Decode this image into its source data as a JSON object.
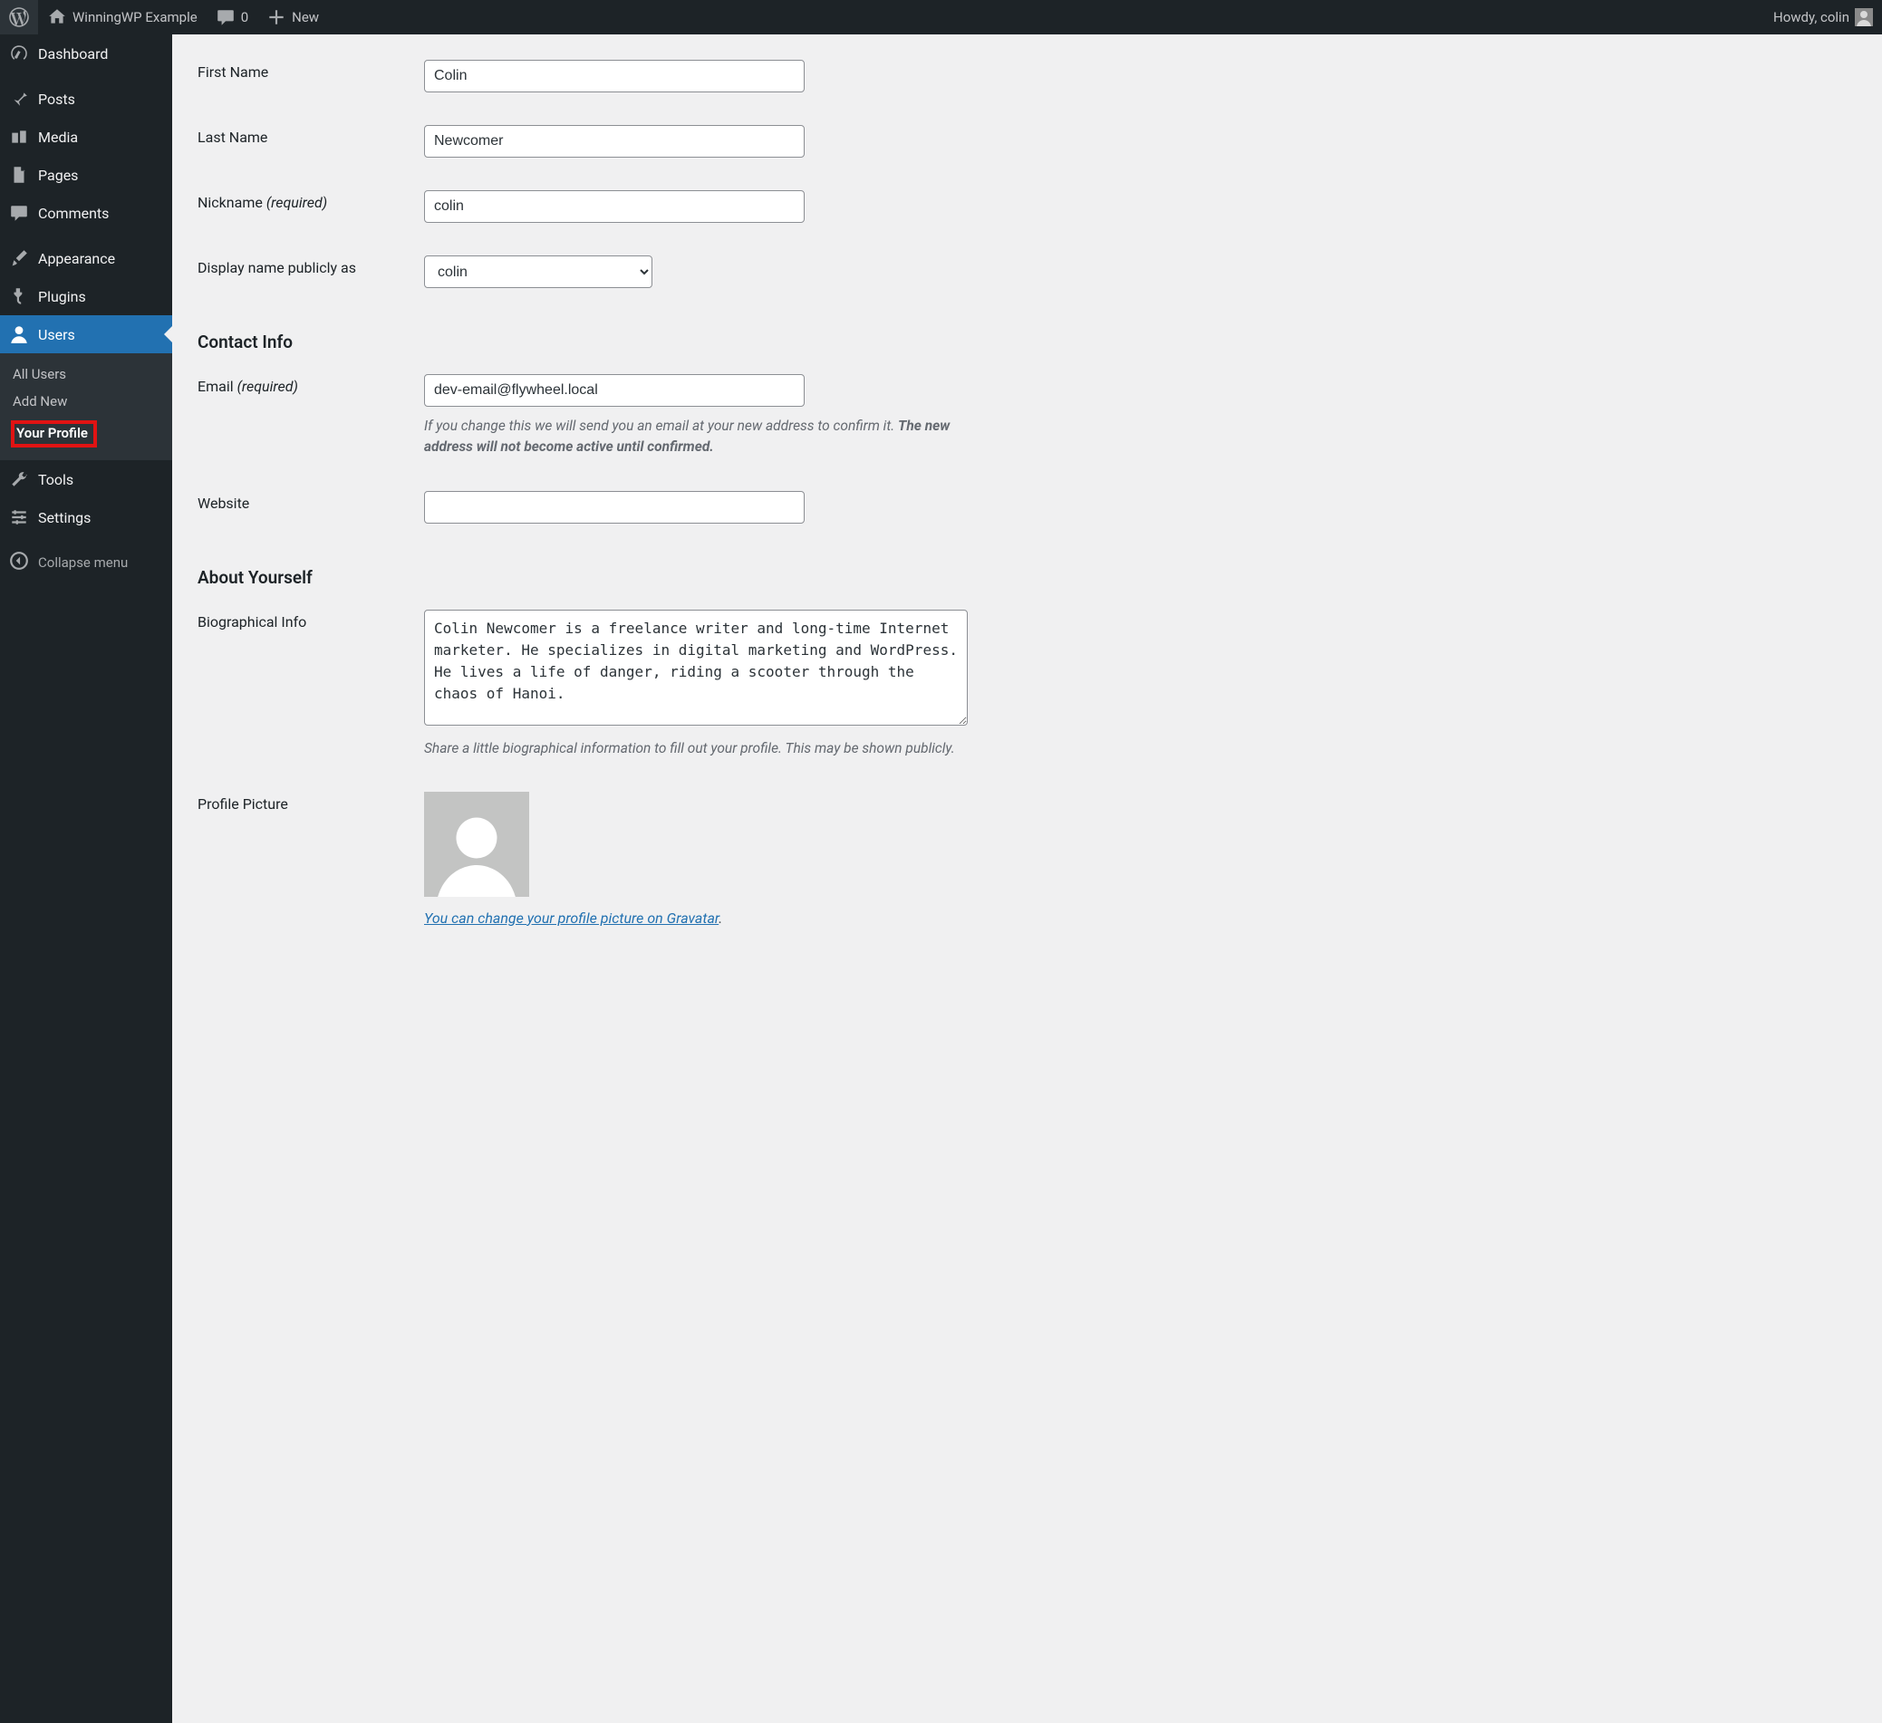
{
  "adminbar": {
    "site_name": "WinningWP Example",
    "comments_count": "0",
    "new_label": "New",
    "greeting": "Howdy, colin"
  },
  "sidebar": {
    "dashboard": "Dashboard",
    "posts": "Posts",
    "media": "Media",
    "pages": "Pages",
    "comments": "Comments",
    "appearance": "Appearance",
    "plugins": "Plugins",
    "users": "Users",
    "users_sub": {
      "all": "All Users",
      "add": "Add New",
      "profile": "Your Profile"
    },
    "tools": "Tools",
    "settings": "Settings",
    "collapse": "Collapse menu"
  },
  "form": {
    "first_name_label": "First Name",
    "first_name_value": "Colin",
    "last_name_label": "Last Name",
    "last_name_value": "Newcomer",
    "nickname_label": "Nickname ",
    "required_text": "(required)",
    "nickname_value": "colin",
    "display_name_label": "Display name publicly as",
    "display_name_value": "colin",
    "contact_heading": "Contact Info",
    "email_label": "Email ",
    "email_value": "dev-email@flywheel.local",
    "email_desc_1": "If you change this we will send you an email at your new address to confirm it. ",
    "email_desc_2": "The new address will not become active until confirmed.",
    "website_label": "Website",
    "website_value": "",
    "about_heading": "About Yourself",
    "bio_label": "Biographical Info",
    "bio_value": "Colin Newcomer is a freelance writer and long-time Internet marketer. He specializes in digital marketing and WordPress. He lives a life of danger, riding a scooter through the chaos of Hanoi.",
    "bio_desc": "Share a little biographical information to fill out your profile. This may be shown publicly.",
    "picture_label": "Profile Picture",
    "gravatar_link": "You can change your profile picture on Gravatar",
    "period": "."
  }
}
